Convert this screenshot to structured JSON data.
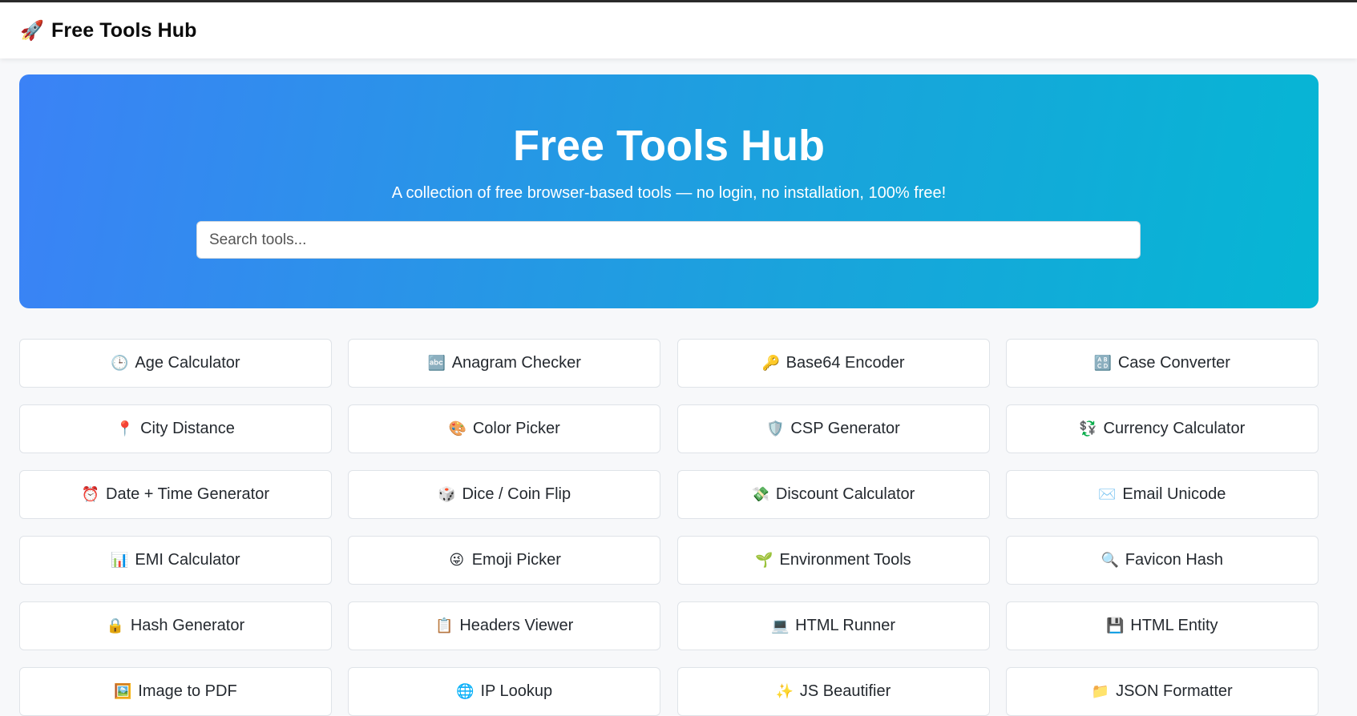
{
  "header": {
    "brand_icon": "rocket-icon",
    "brand_glyph": "🚀",
    "brand_title": "Free Tools Hub"
  },
  "hero": {
    "title": "Free Tools Hub",
    "subtitle": "A collection of free browser-based tools — no login, no installation, 100% free!",
    "search_placeholder": "Search tools...",
    "search_value": "",
    "gradient_start": "#3b82f6",
    "gradient_end": "#06b6d4"
  },
  "tools": [
    {
      "label": "Age Calculator",
      "icon": "clock-icon",
      "glyph": "🕒"
    },
    {
      "label": "Anagram Checker",
      "icon": "abc-icon",
      "glyph": "🔤"
    },
    {
      "label": "Base64 Encoder",
      "icon": "key-icon",
      "glyph": "🔑"
    },
    {
      "label": "Case Converter",
      "icon": "letters-icon",
      "glyph": "🔠"
    },
    {
      "label": "City Distance",
      "icon": "pin-icon",
      "glyph": "📍"
    },
    {
      "label": "Color Picker",
      "icon": "palette-icon",
      "glyph": "🎨"
    },
    {
      "label": "CSP Generator",
      "icon": "shield-icon",
      "glyph": "🛡️"
    },
    {
      "label": "Currency Calculator",
      "icon": "currency-exchange-icon",
      "glyph": "💱"
    },
    {
      "label": "Date + Time Generator",
      "icon": "alarm-clock-icon",
      "glyph": "⏰"
    },
    {
      "label": "Dice / Coin Flip",
      "icon": "dice-icon",
      "glyph": "🎲"
    },
    {
      "label": "Discount Calculator",
      "icon": "money-icon",
      "glyph": "💸"
    },
    {
      "label": "Email Unicode",
      "icon": "envelope-icon",
      "glyph": "✉️"
    },
    {
      "label": "EMI Calculator",
      "icon": "bar-chart-icon",
      "glyph": "📊"
    },
    {
      "label": "Emoji Picker",
      "icon": "smiley-icon",
      "glyph": "😜"
    },
    {
      "label": "Environment Tools",
      "icon": "seedling-icon",
      "glyph": "🌱"
    },
    {
      "label": "Favicon Hash",
      "icon": "magnifier-icon",
      "glyph": "🔍"
    },
    {
      "label": "Hash Generator",
      "icon": "lock-icon",
      "glyph": "🔒"
    },
    {
      "label": "Headers Viewer",
      "icon": "clipboard-icon",
      "glyph": "📋"
    },
    {
      "label": "HTML Runner",
      "icon": "laptop-icon",
      "glyph": "💻"
    },
    {
      "label": "HTML Entity",
      "icon": "floppy-disk-icon",
      "glyph": "💾"
    },
    {
      "label": "Image to PDF",
      "icon": "picture-icon",
      "glyph": "🖼️"
    },
    {
      "label": "IP Lookup",
      "icon": "globe-icon",
      "glyph": "🌐"
    },
    {
      "label": "JS Beautifier",
      "icon": "sparkles-icon",
      "glyph": "✨"
    },
    {
      "label": "JSON Formatter",
      "icon": "folder-icon",
      "glyph": "📁"
    }
  ]
}
